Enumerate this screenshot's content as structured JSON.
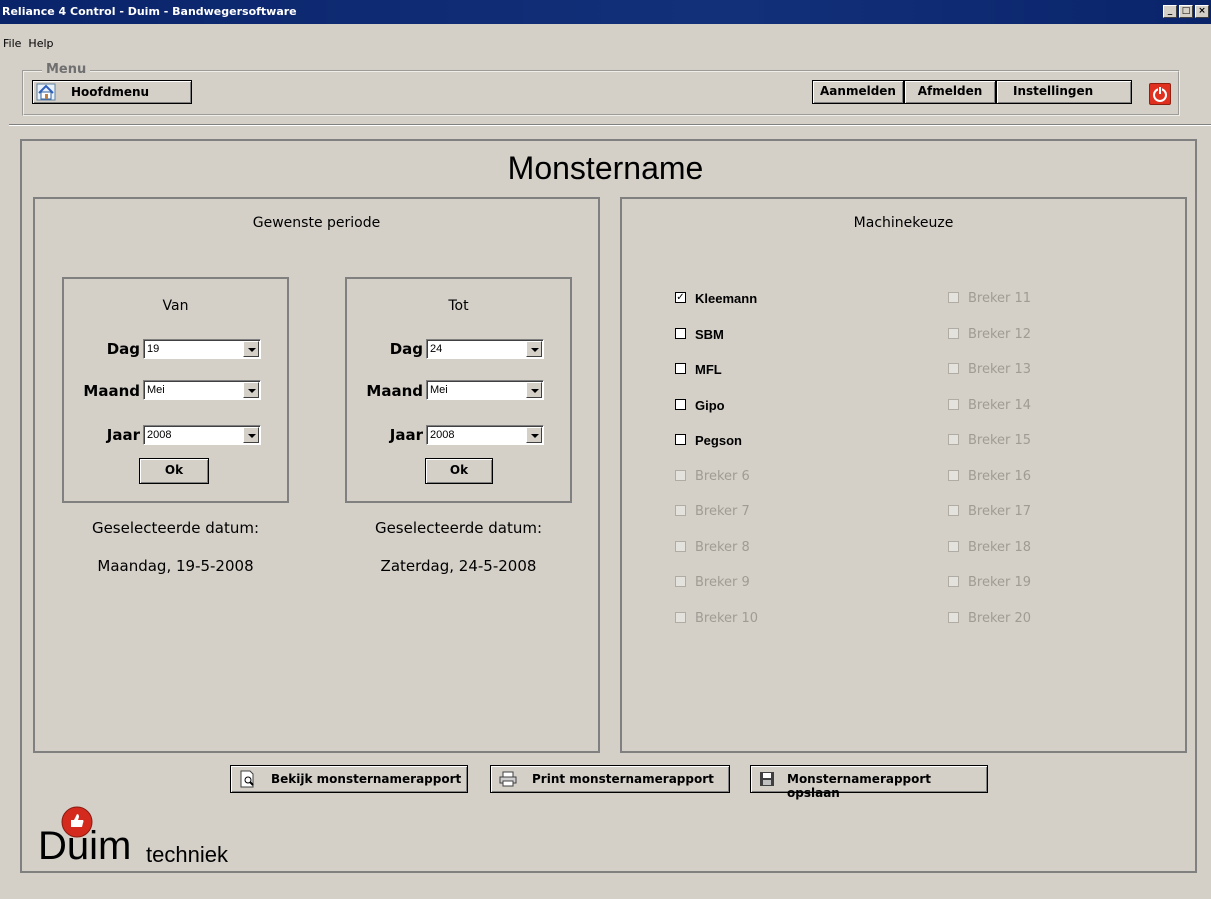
{
  "window": {
    "title": "Reliance 4 Control - Duim - Bandwegersoftware"
  },
  "menubar": {
    "file": "File",
    "help": "Help"
  },
  "menu_group": {
    "legend": "Menu",
    "home_label": "Hoofdmenu",
    "login_label": "Aanmelden",
    "logout_label": "Afmelden",
    "settings_label": "Instellingen"
  },
  "page_title": "Monstername",
  "period": {
    "heading": "Gewenste periode",
    "from": {
      "heading": "Van",
      "day_label": "Dag",
      "day_value": "19",
      "month_label": "Maand",
      "month_value": "Mei",
      "year_label": "Jaar",
      "year_value": "2008",
      "ok_label": "Ok",
      "selected_label": "Geselecteerde datum:",
      "selected_value": "Maandag, 19-5-2008"
    },
    "to": {
      "heading": "Tot",
      "day_label": "Dag",
      "day_value": "24",
      "month_label": "Maand",
      "month_value": "Mei",
      "year_label": "Jaar",
      "year_value": "2008",
      "ok_label": "Ok",
      "selected_label": "Geselecteerde datum:",
      "selected_value": "Zaterdag, 24-5-2008"
    }
  },
  "machines": {
    "heading": "Machinekeuze",
    "left": [
      {
        "label": "Kleemann",
        "checked": true,
        "enabled": true
      },
      {
        "label": "SBM",
        "checked": false,
        "enabled": true
      },
      {
        "label": "MFL",
        "checked": false,
        "enabled": true
      },
      {
        "label": "Gipo",
        "checked": false,
        "enabled": true
      },
      {
        "label": "Pegson",
        "checked": false,
        "enabled": true
      },
      {
        "label": "Breker 6",
        "checked": false,
        "enabled": false
      },
      {
        "label": "Breker 7",
        "checked": false,
        "enabled": false
      },
      {
        "label": "Breker 8",
        "checked": false,
        "enabled": false
      },
      {
        "label": "Breker 9",
        "checked": false,
        "enabled": false
      },
      {
        "label": "Breker 10",
        "checked": false,
        "enabled": false
      }
    ],
    "right": [
      {
        "label": "Breker 11",
        "checked": false,
        "enabled": false
      },
      {
        "label": "Breker 12",
        "checked": false,
        "enabled": false
      },
      {
        "label": "Breker 13",
        "checked": false,
        "enabled": false
      },
      {
        "label": "Breker 14",
        "checked": false,
        "enabled": false
      },
      {
        "label": "Breker 15",
        "checked": false,
        "enabled": false
      },
      {
        "label": "Breker 16",
        "checked": false,
        "enabled": false
      },
      {
        "label": "Breker 17",
        "checked": false,
        "enabled": false
      },
      {
        "label": "Breker 18",
        "checked": false,
        "enabled": false
      },
      {
        "label": "Breker 19",
        "checked": false,
        "enabled": false
      },
      {
        "label": "Breker 20",
        "checked": false,
        "enabled": false
      }
    ]
  },
  "actions": {
    "view_label": "Bekijk monsternamerapport",
    "print_label": "Print monsternamerapport",
    "save_label": "Monsternamerapport opslaan"
  },
  "logo": {
    "brand": "Duim",
    "suffix": "techniek"
  }
}
